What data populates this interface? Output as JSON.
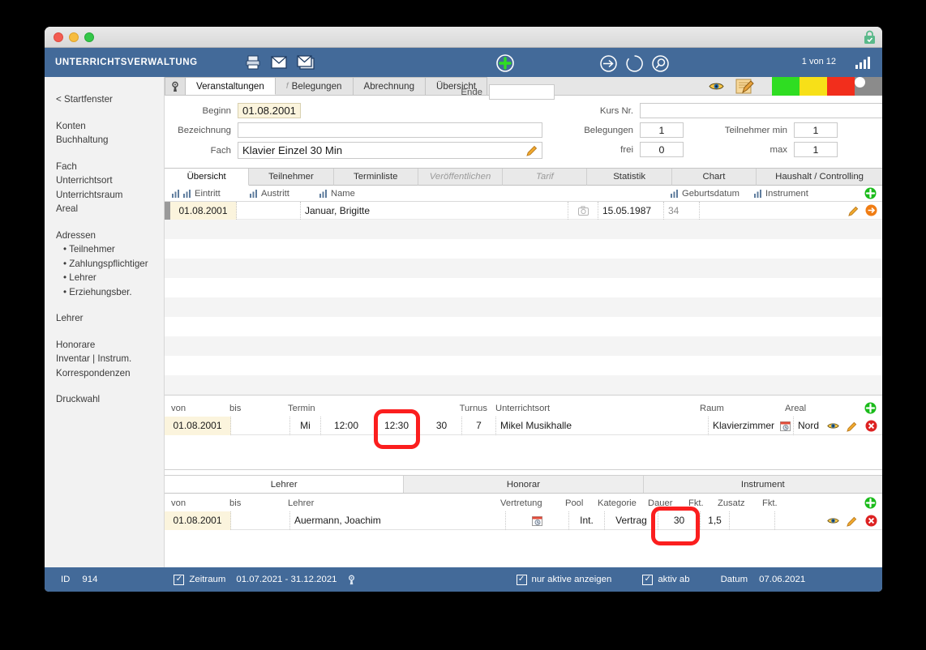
{
  "window": {
    "titlebar": {
      "close": "close",
      "minimize": "minimize",
      "zoom": "zoom",
      "lock": "lock-icon"
    }
  },
  "appbar": {
    "title": "UNTERRICHTSVERWALTUNG",
    "pager": "1 von 12",
    "icons": [
      "printer-icon",
      "mail-icon",
      "mail-stack-icon"
    ],
    "plus": "plus-circle-icon",
    "nav": [
      "arrow-right-circle-icon",
      "refresh-circle-icon",
      "search-circle-icon"
    ],
    "chart": "bar-chart-icon"
  },
  "sidebar": {
    "back": "< Startfenster",
    "groups": [
      {
        "items": [
          "Konten",
          "Buchhaltung"
        ]
      },
      {
        "items": [
          "Fach",
          "Unterrichtsort",
          "Unterrichtsraum",
          "Areal"
        ]
      },
      {
        "items": [
          "Adressen"
        ],
        "subitems": [
          "Teilnehmer",
          "Zahlungspflichtiger",
          "Lehrer",
          "Erziehungsber."
        ]
      },
      {
        "items": [
          "Lehrer"
        ]
      },
      {
        "items": [
          "Honorare",
          "Inventar | Instrum.",
          "Korrespondenzen"
        ]
      },
      {
        "items": [
          "Druckwahl"
        ]
      }
    ]
  },
  "top_tabs": {
    "gear": "gear-icon",
    "tabs": [
      {
        "label": "Veranstaltungen",
        "active": true,
        "icon": null
      },
      {
        "label": "Belegungen",
        "active": false,
        "icon": "f-icon"
      },
      {
        "label": "Abrechnung",
        "active": false,
        "icon": null
      },
      {
        "label": "Übersicht",
        "active": false,
        "icon": null
      }
    ],
    "right": {
      "eye": "eye-icon",
      "note": "note-edit-icon",
      "status_lights": [
        "#2fdd22",
        "#f7e018",
        "#f22e1c",
        "#8b8b8b"
      ]
    }
  },
  "form": {
    "beginn_label": "Beginn",
    "beginn_value": "01.08.2001",
    "ende_label": "Ende",
    "ende_value": "",
    "bezeichnung_label": "Bezeichnung",
    "bezeichnung_value": "",
    "fach_label": "Fach",
    "fach_value": "Klavier Einzel 30 Min",
    "fach_pencil": "pencil-icon",
    "kursnr_label": "Kurs Nr.",
    "kursnr_value": "",
    "belegungen_label": "Belegungen",
    "belegungen_value": "1",
    "teilnehmer_min_label": "Teilnehmer min",
    "teilnehmer_min_value": "1",
    "frei_label": "frei",
    "frei_value": "0",
    "max_label": "max",
    "max_value": "1"
  },
  "mid_tabs": [
    {
      "label": "Übersicht",
      "active": true,
      "dim": false
    },
    {
      "label": "Teilnehmer",
      "active": false,
      "dim": false
    },
    {
      "label": "Terminliste",
      "active": false,
      "dim": false
    },
    {
      "label": "Veröffentlichen",
      "active": false,
      "dim": true
    },
    {
      "label": "Tarif",
      "active": false,
      "dim": true
    },
    {
      "label": "Statistik",
      "active": false,
      "dim": false
    },
    {
      "label": "Chart",
      "active": false,
      "dim": false
    },
    {
      "label": "Haushalt / Controlling",
      "active": false,
      "dim": false
    }
  ],
  "participants_grid": {
    "add_icon": "plus-circle-green-icon",
    "headers": [
      "Eintritt",
      "Austritt",
      "Name",
      "Geburtsdatum",
      "Instrument"
    ],
    "row": {
      "eintritt": "01.08.2001",
      "austritt": "",
      "name": "Januar, Brigitte",
      "photo_icon": "camera-icon",
      "geburtsdatum": "15.05.1987",
      "alter": "34",
      "instrument": "",
      "edit_icon": "pencil-icon",
      "goto_icon": "arrow-right-circle-orange-icon"
    }
  },
  "termin_grid": {
    "add_icon": "plus-circle-green-icon",
    "headers": [
      "von",
      "bis",
      "Termin",
      "Turnus",
      "Unterrichtsort",
      "Raum",
      "Areal"
    ],
    "row": {
      "von": "01.08.2001",
      "bis": "",
      "tag": "Mi",
      "zeit_von": "12:00",
      "zeit_bis": "12:30",
      "dauer": "30",
      "turnus": "7",
      "unterrichtsort": "Mikel Musikhalle",
      "raum": "Klavierzimmer",
      "raum_icon": "calendar-clock-icon",
      "areal": "Nord",
      "view_icon": "eye-icon",
      "edit_icon": "pencil-icon",
      "delete_icon": "delete-circle-red-icon"
    }
  },
  "lehrer_tabs": [
    {
      "label": "Lehrer",
      "active": true
    },
    {
      "label": "Honorar",
      "active": false
    },
    {
      "label": "Instrument",
      "active": false
    }
  ],
  "lehrer_grid": {
    "add_icon": "plus-circle-green-icon",
    "headers": [
      "von",
      "bis",
      "Lehrer",
      "Vertretung",
      "Pool",
      "Kategorie",
      "Dauer",
      "Fkt.",
      "Zusatz",
      "Fkt."
    ],
    "row": {
      "von": "01.08.2001",
      "bis": "",
      "lehrer": "Auermann, Joachim",
      "vertretung_icon": "calendar-clock-icon",
      "pool": "Int.",
      "kategorie": "Vertrag",
      "dauer": "30",
      "fkt1": "1,5",
      "zusatz": "",
      "fkt2": "",
      "view_icon": "eye-icon",
      "edit_icon": "pencil-icon",
      "delete_icon": "delete-circle-red-icon"
    }
  },
  "statusbar": {
    "id_label": "ID",
    "id_value": "914",
    "zeitraum_check": "✓",
    "zeitraum_label": "Zeitraum",
    "zeitraum_value": "01.07.2021  -  31.12.2021",
    "settings_icon": "gear-icon",
    "aktive_check": "✓",
    "aktive_label": "nur aktive anzeigen",
    "aktivab_check": "✓",
    "aktivab_label": "aktiv ab",
    "datum_label": "Datum",
    "datum_value": "07.06.2021"
  },
  "annotations": {
    "highlight_color": "#fb1e1e",
    "boxes": [
      "turnus-dauer-field",
      "lehrer-dauer-field"
    ]
  }
}
